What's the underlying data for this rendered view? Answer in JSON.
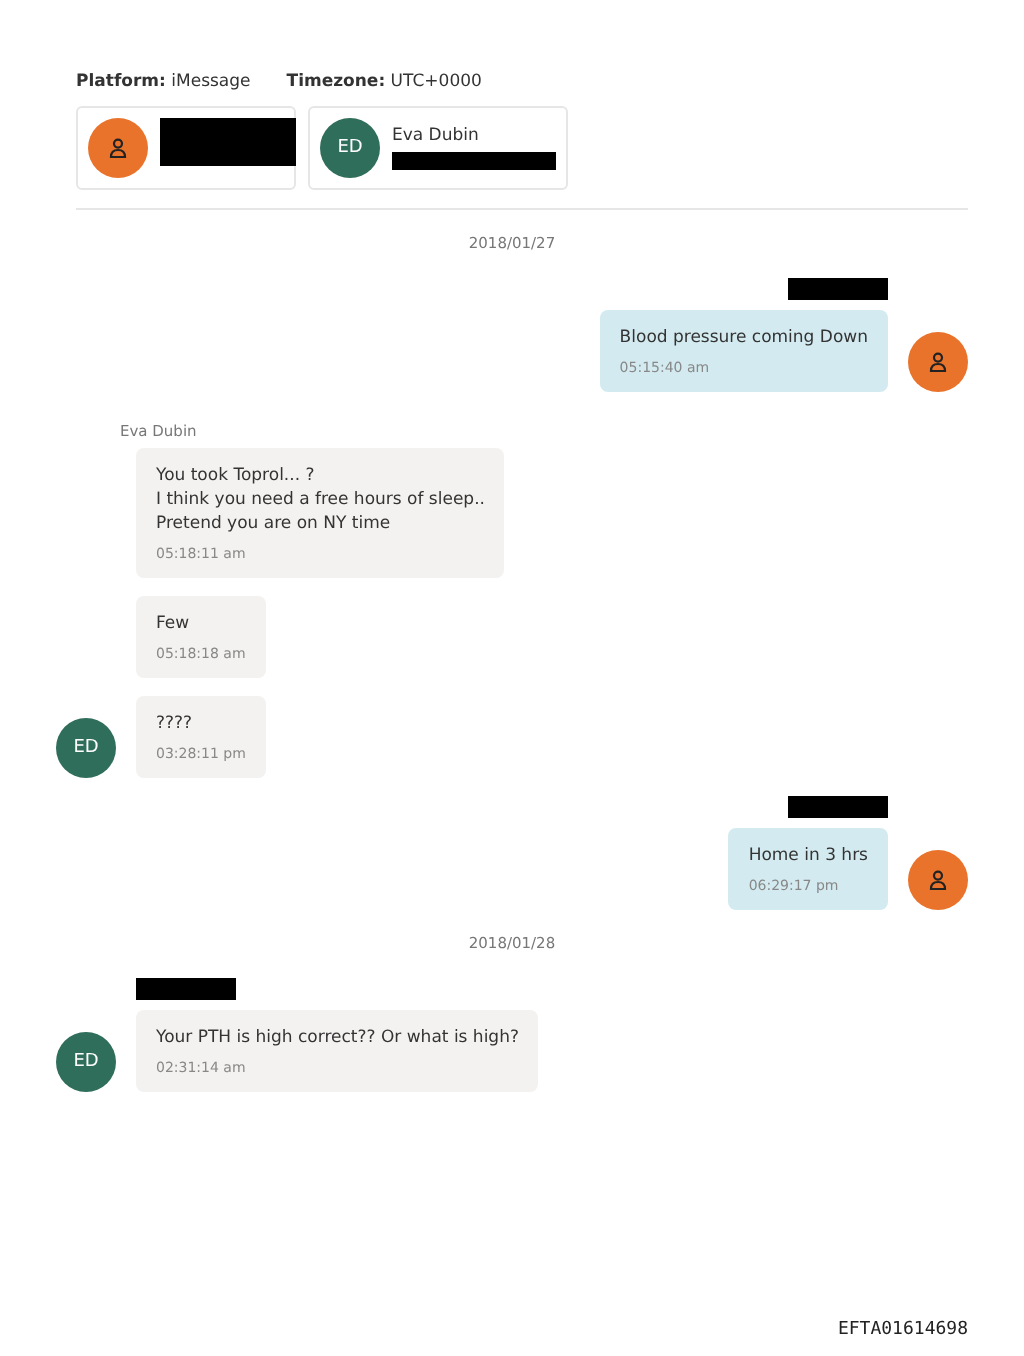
{
  "header": {
    "platform_label": "Platform:",
    "platform": "iMessage",
    "timezone_label": "Timezone:",
    "timezone": "UTC+0000"
  },
  "participants": [
    {
      "kind": "person",
      "redacted": true
    },
    {
      "kind": "initials",
      "initials": "ED",
      "name": "Eva Dubin",
      "redacted": true
    }
  ],
  "items": [
    {
      "kind": "date",
      "text": "2018/01/27"
    },
    {
      "kind": "outgoing",
      "sender_redacted": true,
      "text": "Blood pressure coming Down",
      "time": "05:15:40 am",
      "avatar": true
    },
    {
      "kind": "incoming",
      "sender_redacted": false,
      "sender": "Eva Dubin",
      "text": "You took Toprol... ?\nI think you need a free hours of sleep..\nPretend you are on NY time",
      "time": "05:18:11 am",
      "avatar": false
    },
    {
      "kind": "incoming",
      "sender_redacted": false,
      "text": "Few",
      "time": "05:18:18 am",
      "avatar": false
    },
    {
      "kind": "incoming",
      "sender_redacted": false,
      "text": "????",
      "time": "03:28:11 pm",
      "avatar": true,
      "initials": "ED"
    },
    {
      "kind": "outgoing",
      "sender_redacted": true,
      "text": "Home in 3 hrs",
      "time": "06:29:17 pm",
      "avatar": true
    },
    {
      "kind": "date",
      "text": "2018/01/28"
    },
    {
      "kind": "incoming",
      "sender_redacted": true,
      "text": "Your PTH is high correct?? Or what is high?",
      "time": "02:31:14 am",
      "avatar": true,
      "initials": "ED"
    }
  ],
  "stamp": "EFTA01614698"
}
